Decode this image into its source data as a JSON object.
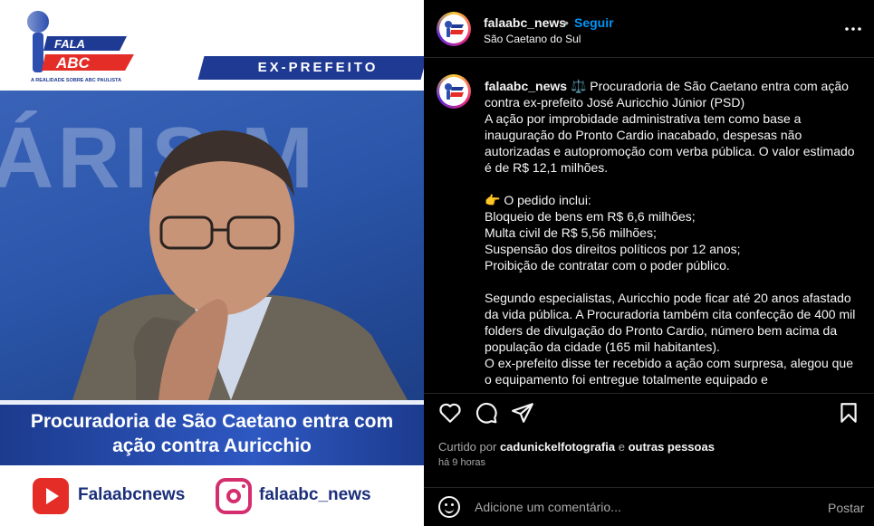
{
  "media": {
    "logo_word1": "FALA",
    "logo_word2": "ABC",
    "logo_tagline": "A REALIDADE SOBRE ABC PAULISTA",
    "banner": "EX-PREFEITO",
    "background_letters": "ÁRIS M",
    "headline_line1": "Procuradoria de São Caetano entra com",
    "headline_line2": "ação contra Auricchio",
    "youtube_handle": "Falaabcnews",
    "instagram_handle": "falaabc_news",
    "colors": {
      "brand_blue": "#1f3a93",
      "brand_red": "#e52d27"
    }
  },
  "header": {
    "username": "falaabc_news",
    "separator": "•",
    "follow_label": "Seguir",
    "location": "São Caetano do Sul",
    "more_icon": "more-horizontal-icon"
  },
  "caption": {
    "username": "falaabc_news",
    "lines": [
      "⚖️ Procuradoria de São Caetano entra com ação contra ex-prefeito José Auricchio Júnior (PSD)",
      "A ação por improbidade administrativa tem como base a inauguração do Pronto Cardio inacabado, despesas não autorizadas e autopromoção com verba pública. O valor estimado é de R$ 12,1 milhões.",
      "",
      "👉 O pedido inclui:",
      "Bloqueio de bens em R$ 6,6 milhões;",
      "Multa civil de R$ 5,56 milhões;",
      "Suspensão dos direitos políticos por 12 anos;",
      "Proibição de contratar com o poder público.",
      "",
      "Segundo especialistas, Auricchio pode ficar até 20 anos afastado da vida pública. A Procuradoria também cita confecção de 400 mil folders de divulgação do Pronto Cardio, número bem acima da população da cidade (165 mil habitantes).",
      "O ex-prefeito disse ter recebido a ação com surpresa, alegou que o equipamento foi entregue totalmente equipado e"
    ]
  },
  "actions": {
    "like_icon": "heart-icon",
    "comment_icon": "comment-icon",
    "share_icon": "share-icon",
    "save_icon": "bookmark-icon"
  },
  "likes": {
    "prefix": "Curtido por",
    "user": "cadunickelfotografia",
    "connector": "e",
    "others": "outras pessoas"
  },
  "time_ago": "há 9 horas",
  "comment": {
    "placeholder": "Adicione um comentário...",
    "post_label": "Postar",
    "emoji_icon": "emoji-icon"
  }
}
